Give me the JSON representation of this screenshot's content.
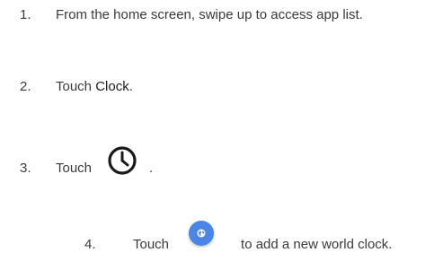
{
  "steps": [
    {
      "number": "1.",
      "text": "From the home screen, swipe up to access app list."
    },
    {
      "number": "2.",
      "prefix": "Touch ",
      "bold": "Clock",
      "suffix": "."
    },
    {
      "number": "3.",
      "prefix": "Touch",
      "icon": "clock-icon",
      "suffix": "."
    },
    {
      "number": "4.",
      "prefix": "Touch",
      "icon": "globe-add-icon",
      "suffix": "to add a new world clock."
    }
  ],
  "colors": {
    "text": "#3a3a3a",
    "icon_dark": "#1a1a1a",
    "accent_blue": "#4a86e8"
  }
}
